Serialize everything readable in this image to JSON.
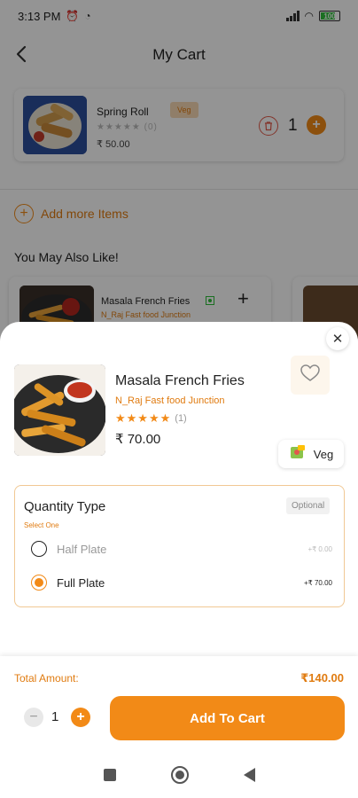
{
  "status_bar": {
    "time": "3:13 PM",
    "battery": "100"
  },
  "header": {
    "title": "My Cart"
  },
  "cart_item": {
    "name": "Spring Roll",
    "tag": "Veg",
    "rating_count": "(0)",
    "price": "₹ 50.00",
    "quantity": "1"
  },
  "add_more": {
    "label": "Add more Items"
  },
  "suggestions": {
    "title": "You May Also Like!",
    "items": [
      {
        "name": "Masala French Fries",
        "restaurant": "N_Raj Fast food Junction"
      }
    ]
  },
  "sheet": {
    "dish": {
      "name": "Masala French Fries",
      "restaurant": "N_Raj Fast food Junction",
      "stars": "★★★★★",
      "rating_count": "(1)",
      "price": "₹ 70.00"
    },
    "veg_label": "Veg",
    "quantity_type": {
      "title": "Quantity Type",
      "badge": "Optional",
      "hint": "Select One",
      "options": [
        {
          "label": "Half Plate",
          "price": "+₹ 0.00",
          "selected": false
        },
        {
          "label": "Full Plate",
          "price": "+₹ 70.00",
          "selected": true
        }
      ]
    }
  },
  "footer": {
    "total_label": "Total Amount:",
    "total_value": "₹140.00",
    "quantity": "1",
    "add_to_cart": "Add To Cart"
  },
  "colors": {
    "accent": "#f28a17",
    "accent_text": "#e07b10",
    "veg_green": "#2dbf3a"
  }
}
